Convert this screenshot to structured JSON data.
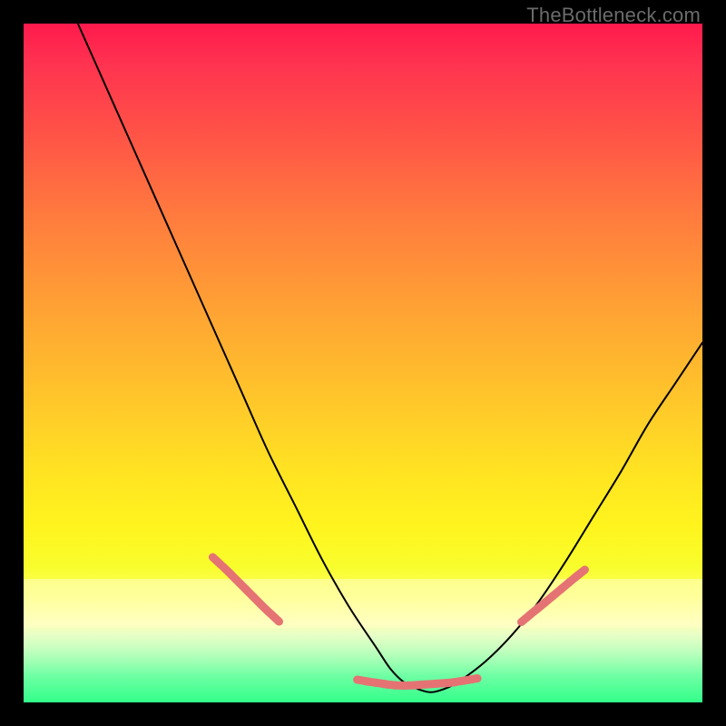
{
  "watermark": "TheBottleneck.com",
  "chart_data": {
    "type": "line",
    "title": "",
    "xlabel": "",
    "ylabel": "",
    "xlim": [
      0,
      100
    ],
    "ylim": [
      0,
      100
    ],
    "grid": false,
    "legend": false,
    "background": {
      "gradient_top_color": "#ff1a4d",
      "gradient_bottom_color": "#33ff8a",
      "description": "vertical red-to-green gradient indicating bottleneck severity from high (top) to none (bottom)"
    },
    "series": [
      {
        "name": "bottleneck-curve",
        "color": "#000000",
        "x": [
          8,
          12,
          16,
          20,
          24,
          28,
          32,
          36,
          40,
          44,
          48,
          52,
          54,
          56,
          58,
          60,
          62,
          64,
          68,
          72,
          76,
          80,
          84,
          88,
          92,
          96,
          100
        ],
        "y": [
          100,
          91,
          82,
          73,
          64,
          55,
          46,
          37,
          29,
          21,
          14,
          8,
          5,
          3,
          2,
          1.5,
          2,
          3,
          6,
          10,
          15,
          21,
          27.5,
          34,
          41,
          47,
          53
        ]
      },
      {
        "name": "highlight-markers-left",
        "color": "#e57373",
        "marker": "round",
        "x": [
          28.5,
          30.0,
          31.2,
          32.4,
          33.2,
          34.4,
          35.6,
          37.0
        ],
        "y": [
          20.8,
          19.4,
          18.2,
          17.0,
          16.2,
          15.0,
          13.8,
          12.5
        ]
      },
      {
        "name": "highlight-markers-bottom",
        "color": "#e57373",
        "marker": "round",
        "x": [
          50.0,
          51.2,
          52.6,
          54.0,
          55.4,
          56.8,
          58.4,
          60.0,
          61.4,
          62.8,
          64.2,
          66.0
        ],
        "y": [
          3.2,
          3.0,
          2.8,
          2.6,
          2.5,
          2.5,
          2.6,
          2.7,
          2.8,
          2.9,
          3.1,
          3.4
        ]
      },
      {
        "name": "highlight-markers-right",
        "color": "#e57373",
        "marker": "round",
        "x": [
          74.0,
          75.2,
          76.2,
          77.4,
          78.6,
          79.8,
          81.0,
          82.0
        ],
        "y": [
          12.4,
          13.4,
          14.2,
          15.2,
          16.2,
          17.2,
          18.2,
          19.0
        ]
      }
    ],
    "annotations": []
  }
}
